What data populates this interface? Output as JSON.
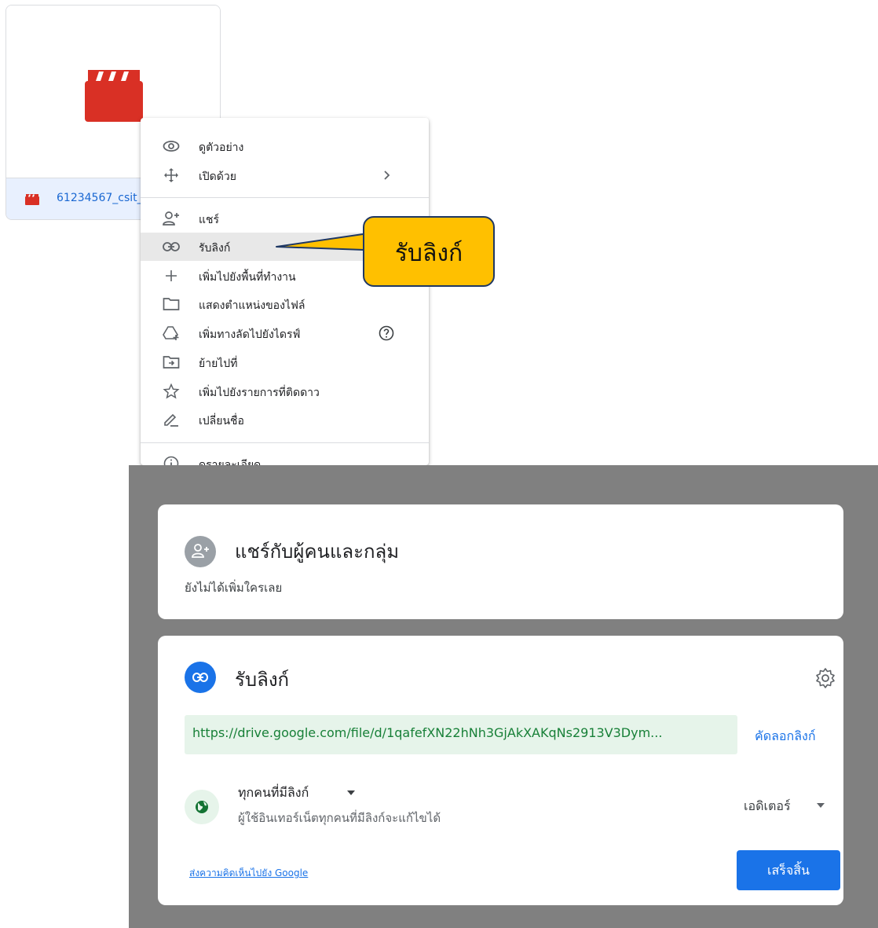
{
  "file": {
    "name": "61234567_csit_",
    "icon": "video-clapperboard-icon",
    "icon_color": "#d93025"
  },
  "context_menu": {
    "items": [
      {
        "label": "ดูตัวอย่าง",
        "icon": "eye-icon"
      },
      {
        "label": "เปิดด้วย",
        "icon": "open-with-icon",
        "right_icon": "chevron-right-icon"
      },
      {
        "label": "แชร์",
        "icon": "person-add-icon"
      },
      {
        "label": "รับลิงก์",
        "icon": "link-icon",
        "highlighted": true
      },
      {
        "label": "เพิ่มไปยังพื้นที่ทำงาน",
        "icon": "plus-icon"
      },
      {
        "label": "แสดงตำแหน่งของไฟล์",
        "icon": "folder-icon"
      },
      {
        "label": "เพิ่มทางลัดไปยังไดรฟ์",
        "icon": "drive-add-icon",
        "right_icon": "help-icon"
      },
      {
        "label": "ย้ายไปที่",
        "icon": "move-to-icon"
      },
      {
        "label": "เพิ่มไปยังรายการที่ติดดาว",
        "icon": "star-icon"
      },
      {
        "label": "เปลี่ยนชื่อ",
        "icon": "pencil-icon"
      },
      {
        "label": "ดูรายละเอียด",
        "icon": "info-icon"
      }
    ]
  },
  "callout": {
    "text": "รับลิงก์",
    "fill": "#ffc000",
    "border": "#1f3864"
  },
  "share_dialog": {
    "people": {
      "title": "แชร์กับผู้คนและกลุ่ม",
      "subtitle": "ยังไม่ได้เพิ่มใครเลย",
      "icon": "person-add-icon"
    },
    "link": {
      "title": "รับลิงก์",
      "icon": "link-icon",
      "url": "https://drive.google.com/file/d/1qafefXN22hNh3GjAkXAKqNs2913V3Dym...",
      "copy_label": "คัดลอกลิงก์",
      "settings_icon": "gear-icon",
      "scope": "ทุกคนที่มีลิงก์",
      "scope_desc": "ผู้ใช้อินเทอร์เน็ตทุกคนที่มีลิงก์จะแก้ไขได้",
      "role": "เอดิเตอร์",
      "feedback_label": "ส่งความคิดเห็นไปยัง Google",
      "done_label": "เสร็จสิ้น"
    },
    "colors": {
      "primary": "#1a73e8",
      "link_bg": "#e6f4ea",
      "link_text": "#188038",
      "overlay": "#808080"
    }
  }
}
